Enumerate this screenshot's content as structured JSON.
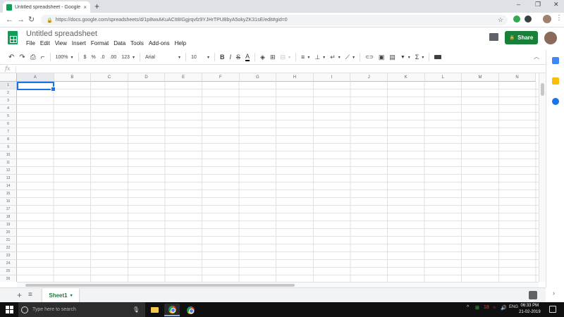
{
  "browser": {
    "tab_title": "Untitled spreadsheet - Google Sh",
    "tab_close": "×",
    "new_tab": "+",
    "url": "https://docs.google.com/spreadsheets/d/1p8wxAKuACIt8IGgjrqvfz9YJHrTPUBbyA5okyZK31sE/edit#gid=0",
    "win_min": "–",
    "win_max": "❐",
    "win_close": "✕",
    "back": "←",
    "forward": "→",
    "reload": "↻",
    "star": "☆",
    "menu": "⋮"
  },
  "doc": {
    "title": "Untitled spreadsheet",
    "menus": [
      "File",
      "Edit",
      "View",
      "Insert",
      "Format",
      "Data",
      "Tools",
      "Add-ons",
      "Help"
    ],
    "share_label": "Share",
    "share_lock": "🔒"
  },
  "toolbar": {
    "undo": "↶",
    "redo": "↷",
    "print": "⎙",
    "paint_format": "⌐",
    "zoom": "100%",
    "currency": "$",
    "percent": "%",
    "dec_decrease": ".0",
    "dec_increase": ".00",
    "more_formats": "123",
    "font": "Arial",
    "font_size": "10",
    "bold": "B",
    "italic": "I",
    "strike": "S",
    "text_color": "A",
    "fill": "◈",
    "borders": "⊞",
    "merge": "⊟",
    "halign": "≡",
    "valign": "⊥",
    "wrap": "↵",
    "rotate": "⟋",
    "link": "⊂⊃",
    "comment": "▣",
    "chart": "▤",
    "filter": "▼",
    "functions": "Σ",
    "collapse": "︿"
  },
  "formula_bar": {
    "fx": "fx",
    "value": ""
  },
  "grid": {
    "columns": [
      "A",
      "B",
      "C",
      "D",
      "E",
      "F",
      "G",
      "H",
      "I",
      "J",
      "K",
      "L",
      "M",
      "N"
    ],
    "rows": [
      "1",
      "2",
      "3",
      "4",
      "5",
      "6",
      "7",
      "8",
      "9",
      "10",
      "11",
      "12",
      "13",
      "14",
      "15",
      "16",
      "17",
      "18",
      "19",
      "20",
      "21",
      "22",
      "23",
      "24",
      "25",
      "26"
    ],
    "active_cell": "A1"
  },
  "sheets": {
    "add": "+",
    "all": "≡",
    "active": "Sheet1",
    "caret": "▾"
  },
  "taskbar": {
    "search_placeholder": "Type here to search",
    "mic": "🎙",
    "tray_up": "^",
    "tray_items": [
      "⊞",
      "18",
      "☼",
      "🔊",
      "ENG"
    ],
    "time": "06:33 PM",
    "date": "21-02-2019"
  },
  "colors": {
    "sheets_green": "#0f9d58",
    "share_green": "#188038",
    "selection_blue": "#1a73e8"
  }
}
